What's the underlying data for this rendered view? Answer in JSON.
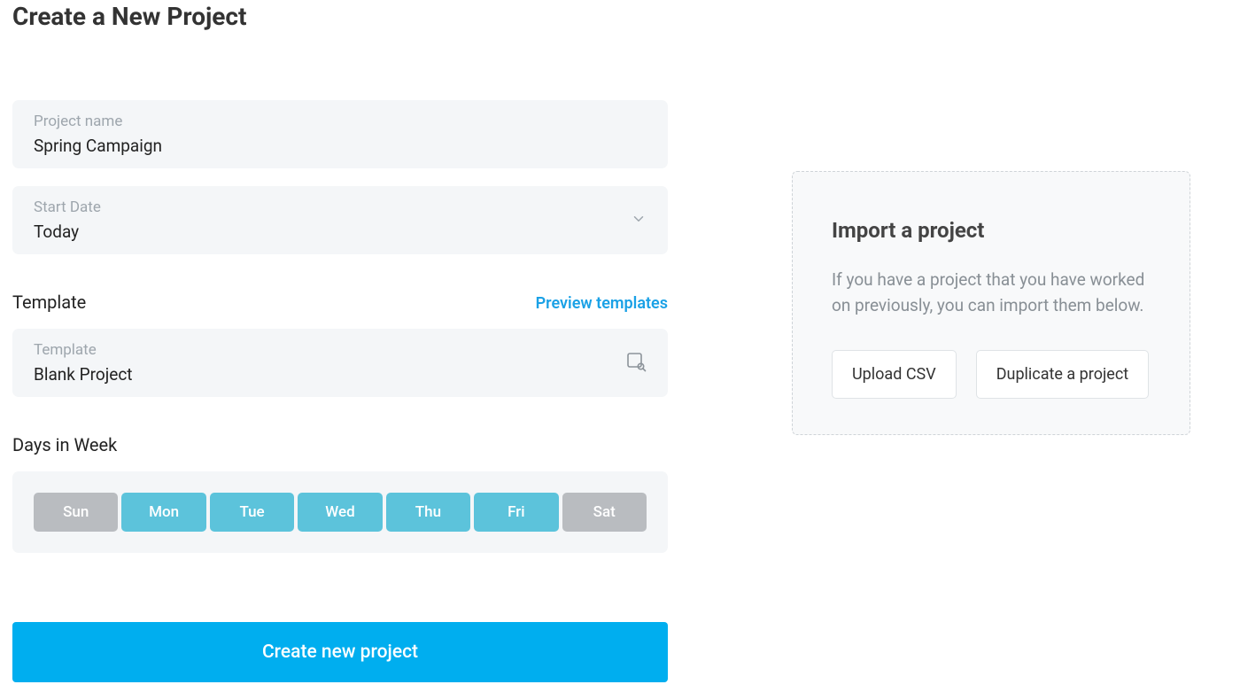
{
  "page": {
    "title": "Create a New Project"
  },
  "form": {
    "project_name": {
      "label": "Project name",
      "value": "Spring Campaign"
    },
    "start_date": {
      "label": "Start Date",
      "value": "Today"
    },
    "template_section": {
      "title": "Template",
      "preview_link": "Preview templates",
      "field_label": "Template",
      "value": "Blank Project"
    },
    "days_section": {
      "title": "Days in Week",
      "days": [
        {
          "short": "Sun",
          "active": false
        },
        {
          "short": "Mon",
          "active": true
        },
        {
          "short": "Tue",
          "active": true
        },
        {
          "short": "Wed",
          "active": true
        },
        {
          "short": "Thu",
          "active": true
        },
        {
          "short": "Fri",
          "active": true
        },
        {
          "short": "Sat",
          "active": false
        }
      ]
    },
    "submit_label": "Create new project"
  },
  "import": {
    "title": "Import a project",
    "description": "If you have a project that you have worked on previously, you can import them below.",
    "upload_label": "Upload CSV",
    "duplicate_label": "Duplicate a project"
  },
  "colors": {
    "primary": "#00aeef",
    "day_active": "#5cc3db",
    "day_inactive": "#b9bcc0",
    "link": "#1aa1e6",
    "field_bg": "#f4f6f8"
  }
}
